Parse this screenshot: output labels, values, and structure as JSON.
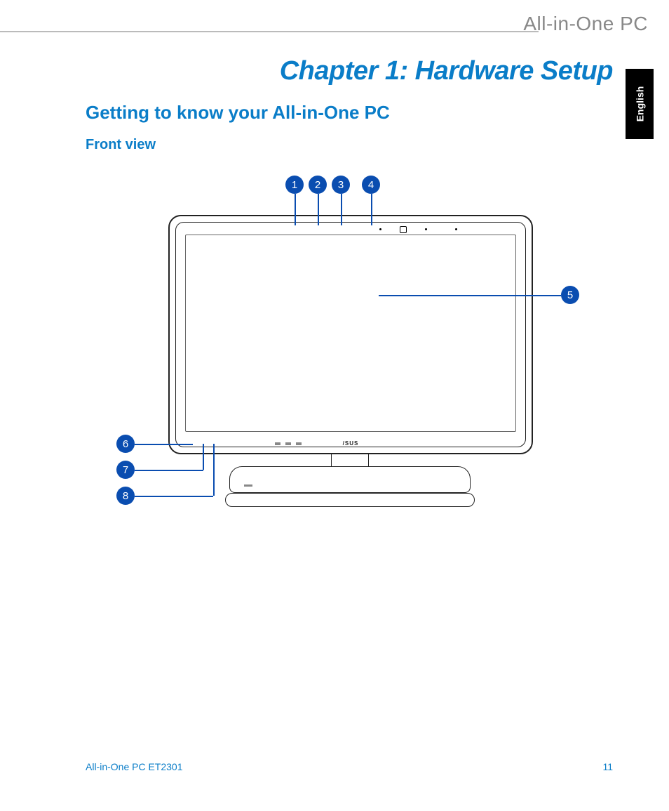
{
  "brand": "All-in-One PC",
  "chapter_title": "Chapter 1: Hardware Setup",
  "section_title": "Getting to know your All-in-One PC",
  "subsection_title": "Front view",
  "language_tab": "English",
  "callouts": {
    "c1": "1",
    "c2": "2",
    "c3": "3",
    "c4": "4",
    "c5": "5",
    "c6": "6",
    "c7": "7",
    "c8": "8"
  },
  "footer": {
    "model": "All-in-One PC ET2301",
    "page_number": "11"
  }
}
